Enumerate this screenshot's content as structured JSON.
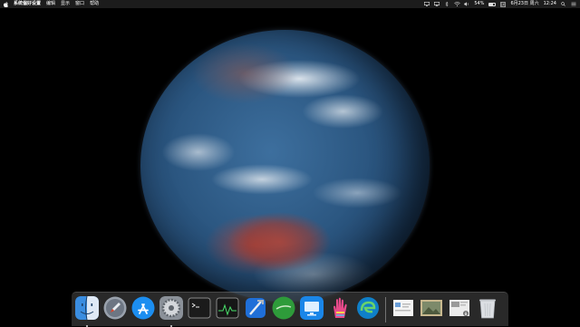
{
  "menubar": {
    "app_name": "系统偏好设置",
    "menus": [
      "编辑",
      "显示",
      "窗口",
      "帮助"
    ],
    "battery_percent": "54%",
    "battery_level": 0.54,
    "date": "6月23日 周六",
    "time": "12:24"
  },
  "dock": {
    "items": [
      {
        "icon": "finder-icon",
        "running": true
      },
      {
        "icon": "launchpad-icon",
        "running": false
      },
      {
        "icon": "app-store-icon",
        "running": false
      },
      {
        "icon": "system-preferences-icon",
        "running": true
      },
      {
        "icon": "terminal-icon",
        "running": false
      },
      {
        "icon": "activity-monitor-icon",
        "running": false
      },
      {
        "icon": "xcode-icon",
        "running": false
      },
      {
        "icon": "green-app-icon",
        "running": false
      },
      {
        "icon": "remote-desktop-icon",
        "running": false
      },
      {
        "icon": "hand-app-icon",
        "running": false
      },
      {
        "icon": "edge-browser-icon",
        "running": false
      }
    ],
    "stacks": [
      {
        "icon": "document-stack-icon"
      },
      {
        "icon": "photo-stack-icon"
      },
      {
        "icon": "downloads-stack-icon"
      },
      {
        "icon": "trash-icon"
      }
    ]
  },
  "colors": {
    "menubar_bg": "#1c1c1c",
    "desktop_bg": "#000000",
    "ocean": "#2b5680",
    "land": "#a8443a"
  }
}
